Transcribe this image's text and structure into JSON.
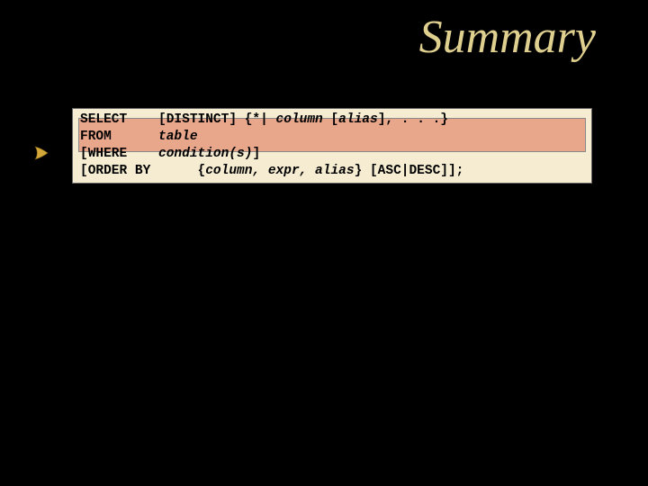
{
  "title": "Summary",
  "code": {
    "l1a": "SELECT    [DISTINCT] {*| ",
    "l1b": "column ",
    "l1c": "[",
    "l1d": "alias",
    "l1e": "], . . .}",
    "l2a": "FROM      ",
    "l2b": "table",
    "l3a": "[WHERE    ",
    "l3b": "condition(s)",
    "l3c": "]",
    "l4a": "[ORDER BY      {",
    "l4b": "column, expr, alias",
    "l4c": "} [ASC|DESC]];"
  }
}
